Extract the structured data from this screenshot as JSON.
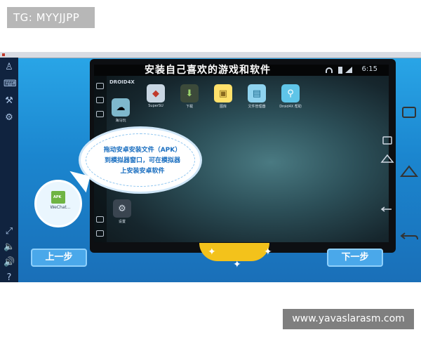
{
  "badge": {
    "text": "TG: MYYJJPP"
  },
  "watermark": {
    "text": "www.yavaslarasm.com"
  },
  "emulator": {
    "headline": "安装自己喜欢的游戏和软件",
    "status_time": "6:15",
    "dock_logo": "DROID4X",
    "apps": [
      {
        "label": "SuperSU",
        "icon": "supersu-icon",
        "color": "#c9d6e2"
      },
      {
        "label": "下载",
        "icon": "download-icon",
        "color": "#3c4a3a"
      },
      {
        "label": "图库",
        "icon": "gallery-icon",
        "color": "#ffe16b"
      },
      {
        "label": "文件管理器",
        "icon": "folder-icon",
        "color": "#8fd3ef"
      },
      {
        "label": "Droid4X 帮助",
        "icon": "help-bulb-icon",
        "color": "#5fc5e8"
      }
    ],
    "side_app_label": "海马玩",
    "settings_label": "设置"
  },
  "bubble": {
    "lines": [
      "拖动安卓安装文件（APK）",
      "到模拟器窗口，可在模拟器",
      "上安装安卓软件"
    ]
  },
  "apk": {
    "tag": "APK",
    "name": "WeChat..."
  },
  "buttons": {
    "prev": "上一步",
    "next": "下一步"
  },
  "colors": {
    "accent": "#4aa8ea",
    "background": "#1b86cf",
    "text_blue": "#1b6fc0"
  }
}
